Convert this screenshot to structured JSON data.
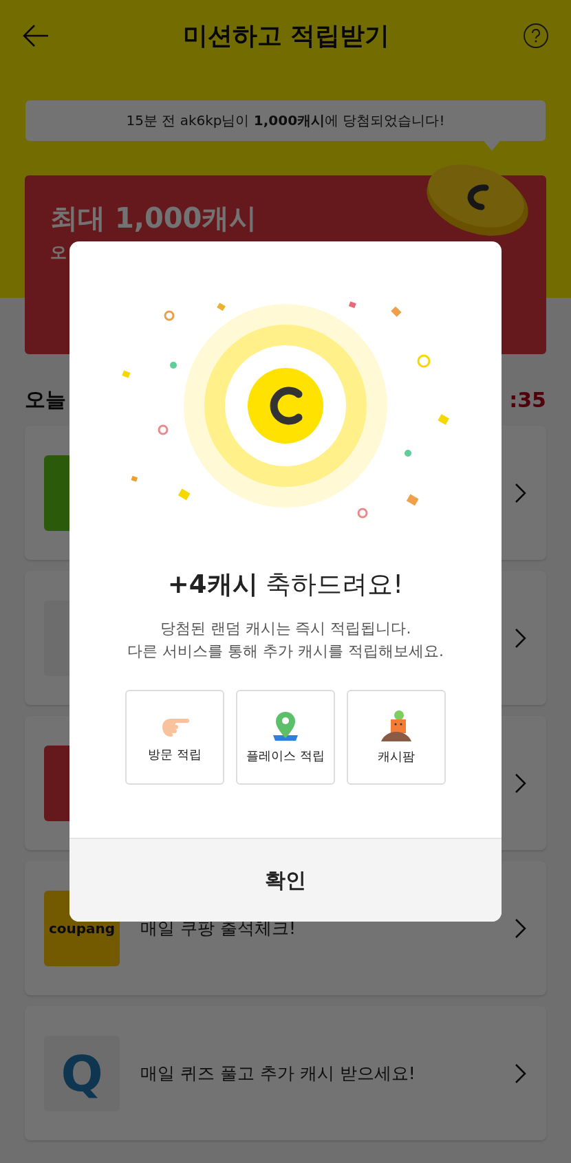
{
  "header": {
    "title": "미션하고 적립받기"
  },
  "notice": {
    "text": "15분 전 ak6kp님이 **1,000캐시**에 당첨되었습니다!"
  },
  "banner": {
    "title": "최대 1,000캐시",
    "subtitle": "오"
  },
  "section": {
    "title": "오늘",
    "timer": ":35"
  },
  "missions": [
    {
      "kind": "green"
    },
    {
      "kind": "tilted"
    },
    {
      "kind": "red"
    },
    {
      "kind": "wordmark",
      "logo_text": "coupang",
      "text": "매일 쿠팡 출석체크!"
    },
    {
      "kind": "letter",
      "logo_text": "Q",
      "text": "매일 퀴즈 풀고 추가 캐시 받으세요!"
    }
  ],
  "dialog": {
    "title": "**+4캐시** 축하드려요!",
    "description": [
      "당첨된 랜덤 캐시는 즉시 적립됩니다.",
      "다른 서비스를 통해 추가 캐시를 적립해보세요."
    ],
    "shortcuts": [
      {
        "label": "방문 적립",
        "kind": "hand"
      },
      {
        "label": "플레이스 적립",
        "kind": "pin"
      },
      {
        "label": "캐시팜",
        "kind": "carrot"
      }
    ],
    "confirm": "확인"
  }
}
